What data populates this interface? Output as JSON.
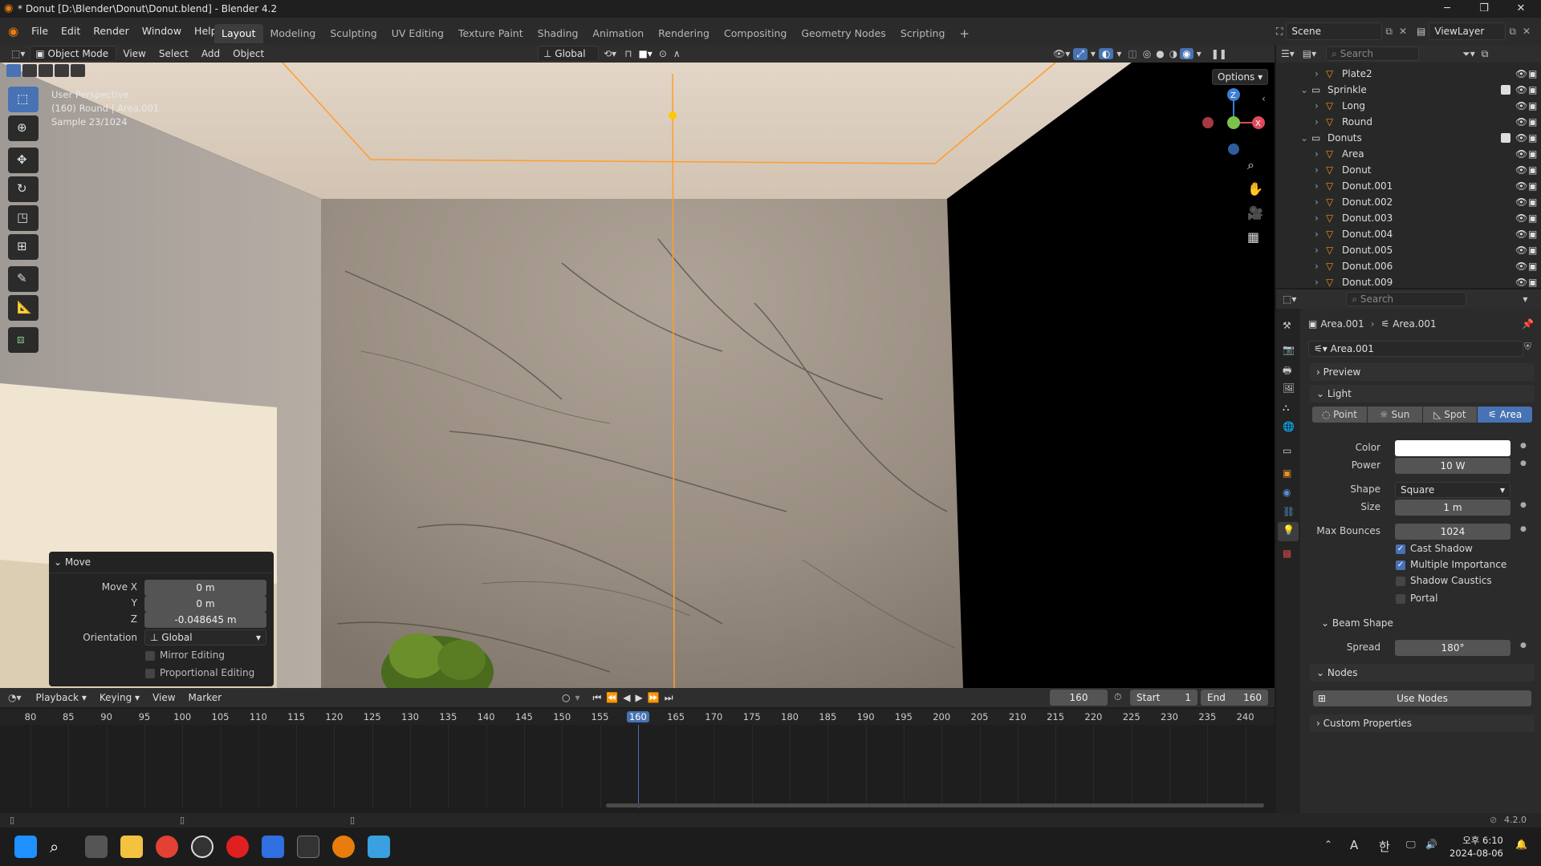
{
  "window": {
    "title": "* Donut [D:\\Blender\\Donut\\Donut.blend] - Blender 4.2"
  },
  "menu": [
    "File",
    "Edit",
    "Render",
    "Window",
    "Help"
  ],
  "workspaces": [
    "Layout",
    "Modeling",
    "Sculpting",
    "UV Editing",
    "Texture Paint",
    "Shading",
    "Animation",
    "Rendering",
    "Compositing",
    "Geometry Nodes",
    "Scripting"
  ],
  "active_workspace": "Layout",
  "scene": {
    "name": "Scene",
    "view_layer": "ViewLayer"
  },
  "viewport_header": {
    "mode": "Object Mode",
    "menus": [
      "View",
      "Select",
      "Add",
      "Object"
    ],
    "orientation": "Global",
    "options": "Options"
  },
  "viewport_info": {
    "line1": "User Perspective",
    "line2": "(160) Round | Area.001",
    "line3": "Sample 23/1024"
  },
  "gizmo": {
    "z": "Z",
    "x": "X"
  },
  "operator_panel": {
    "title": "Move",
    "move_x_label": "Move X",
    "move_x": "0 m",
    "y_label": "Y",
    "y": "0 m",
    "z_label": "Z",
    "z": "-0.048645 m",
    "orientation_label": "Orientation",
    "orientation": "Global",
    "mirror": "Mirror Editing",
    "proportional": "Proportional Editing"
  },
  "outliner": {
    "search_placeholder": "Search",
    "rows": [
      {
        "name": "Plate2",
        "indent": 2
      },
      {
        "name": "Sprinkle",
        "indent": 1
      },
      {
        "name": "Long",
        "indent": 2
      },
      {
        "name": "Round",
        "indent": 2
      },
      {
        "name": "Donuts",
        "indent": 1
      },
      {
        "name": "Area",
        "indent": 2
      },
      {
        "name": "Donut",
        "indent": 2
      },
      {
        "name": "Donut.001",
        "indent": 2
      },
      {
        "name": "Donut.002",
        "indent": 2
      },
      {
        "name": "Donut.003",
        "indent": 2
      },
      {
        "name": "Donut.004",
        "indent": 2
      },
      {
        "name": "Donut.005",
        "indent": 2
      },
      {
        "name": "Donut.006",
        "indent": 2
      },
      {
        "name": "Donut.009",
        "indent": 2
      }
    ]
  },
  "properties": {
    "search_placeholder": "Search",
    "breadcrumb_obj": "Area.001",
    "breadcrumb_data": "Area.001",
    "datablock": "Area.001",
    "preview": "Preview",
    "light": "Light",
    "light_types": [
      "Point",
      "Sun",
      "Spot",
      "Area"
    ],
    "active_light_type": "Area",
    "color_label": "Color",
    "power_label": "Power",
    "power": "10 W",
    "shape_label": "Shape",
    "shape": "Square",
    "size_label": "Size",
    "size": "1 m",
    "max_bounces_label": "Max Bounces",
    "max_bounces": "1024",
    "cast_shadow": "Cast Shadow",
    "multiple_importance": "Multiple Importance",
    "shadow_caustics": "Shadow Caustics",
    "portal": "Portal",
    "beam_shape": "Beam Shape",
    "spread_label": "Spread",
    "spread": "180°",
    "nodes": "Nodes",
    "use_nodes": "Use Nodes",
    "custom_properties": "Custom Properties"
  },
  "timeline": {
    "menus": [
      "Playback",
      "Keying",
      "View",
      "Marker"
    ],
    "current_frame": "160",
    "start_label": "Start",
    "start": "1",
    "end_label": "End",
    "end": "160",
    "ticks": [
      "80",
      "85",
      "90",
      "95",
      "100",
      "105",
      "110",
      "115",
      "120",
      "125",
      "130",
      "135",
      "140",
      "145",
      "150",
      "155",
      "160",
      "165",
      "170",
      "175",
      "180",
      "185",
      "190",
      "195",
      "200",
      "205",
      "210",
      "215",
      "220",
      "225",
      "230",
      "235",
      "240"
    ]
  },
  "status": {
    "version": "4.2.0"
  },
  "taskbar": {
    "clock_time": "오후 6:10",
    "clock_date": "2024-08-06",
    "lang1": "A",
    "lang2": "한"
  },
  "colors": {
    "accent": "#4772b3",
    "selection": "#ffa030",
    "light_type_active": "#4772b3"
  }
}
